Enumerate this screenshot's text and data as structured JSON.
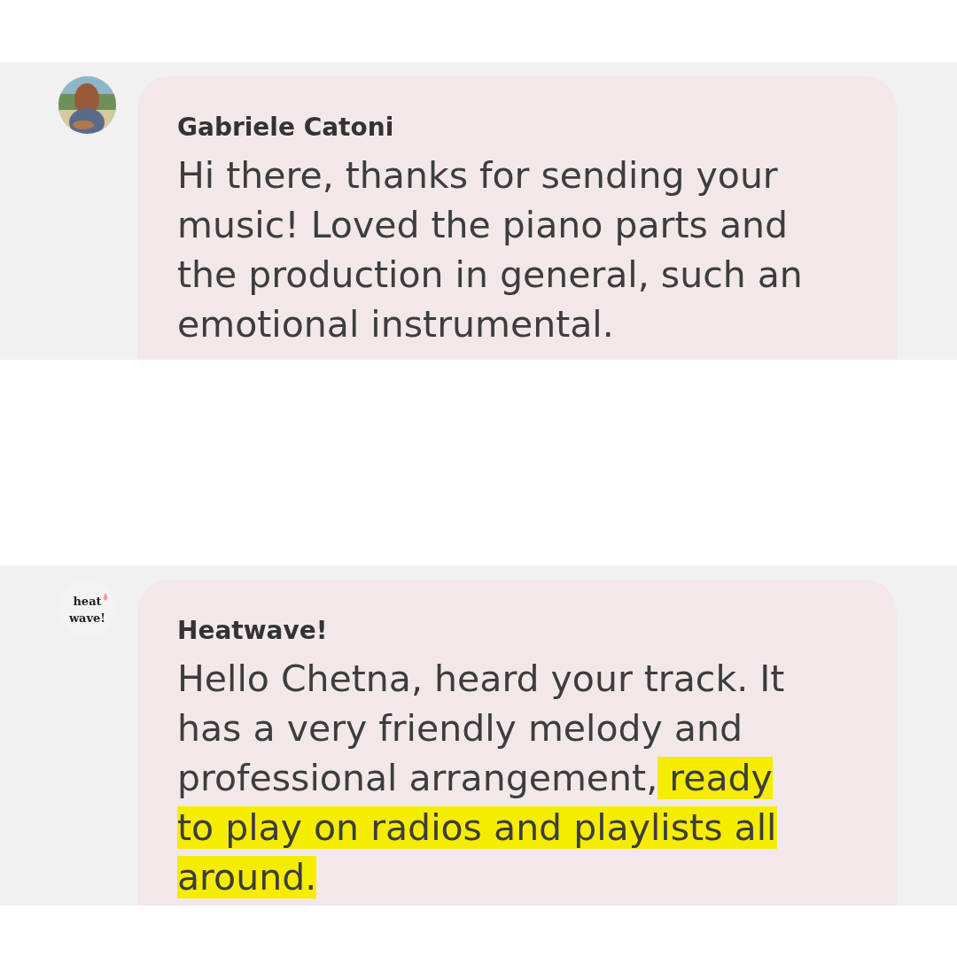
{
  "messages": [
    {
      "sender": "Gabriele Catoni",
      "avatar": {
        "kind": "picture"
      },
      "lines": [
        [
          {
            "text": "Hi there, thanks for sending your",
            "highlighted": false
          }
        ],
        [
          {
            "text": "music! Loved the piano parts and",
            "highlighted": false
          }
        ],
        [
          {
            "text": "the production in general, such an",
            "highlighted": false
          }
        ],
        [
          {
            "text": "emotional instrumental.",
            "highlighted": false
          }
        ]
      ]
    },
    {
      "sender": "Heatwave!",
      "avatar": {
        "kind": "logo",
        "logo_lines": [
          "heat",
          "wave!"
        ]
      },
      "lines": [
        [
          {
            "text": "Hello Chetna, heard your track. It",
            "highlighted": false
          }
        ],
        [
          {
            "text": "has a very friendly melody and",
            "highlighted": false
          }
        ],
        [
          {
            "text": "professional arrangement,",
            "highlighted": false
          },
          {
            "text": " ready",
            "highlighted": true
          }
        ],
        [
          {
            "text": "to play on radios and playlists all",
            "highlighted": true
          }
        ],
        [
          {
            "text": "around.",
            "highlighted": true
          }
        ]
      ]
    }
  ]
}
